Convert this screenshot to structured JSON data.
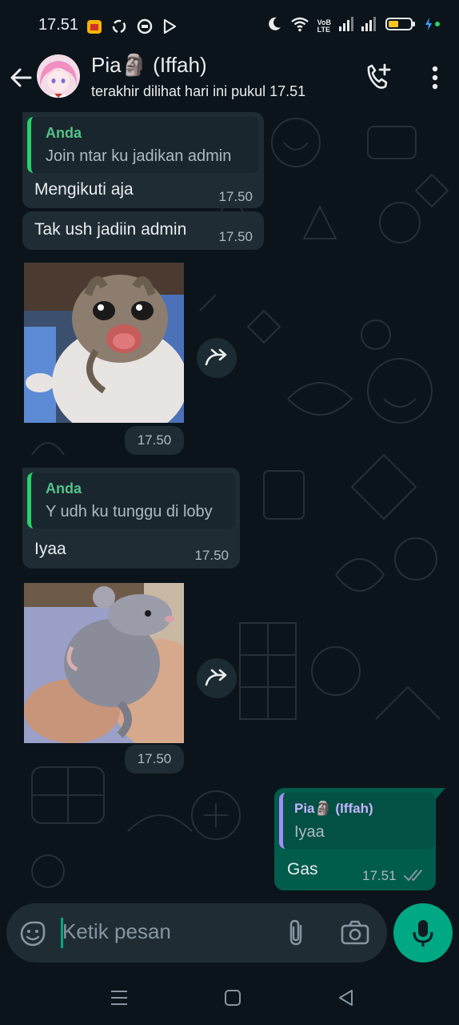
{
  "status_bar": {
    "time": "17.51",
    "net_label_top": "VoB",
    "net_label_bottom": "LTE",
    "app_icons": [
      "app-badge-icon",
      "sync-icon",
      "message-icon",
      "play-store-icon"
    ],
    "right_icons": [
      "moon-icon",
      "wifi-icon",
      "signal-icon",
      "battery-icon",
      "charging-icon"
    ]
  },
  "header": {
    "contact_name": "Pia🗿 (Iffah)",
    "last_seen": "terakhir dilihat hari ini pukul 17.51",
    "icons": [
      "back-arrow-icon",
      "avatar",
      "add-call-icon",
      "more-vertical-icon"
    ]
  },
  "messages": [
    {
      "direction": "in",
      "quote_author": "Anda",
      "quote_text": "Join ntar ku jadikan admin",
      "text": "Mengikuti aja",
      "time": "17.50"
    },
    {
      "direction": "in",
      "text": "Tak ush jadiin admin",
      "time": "17.50"
    },
    {
      "direction": "in",
      "type": "sticker",
      "sticker": "cat-sticker",
      "time": "17.50"
    },
    {
      "direction": "in",
      "quote_author": "Anda",
      "quote_text": "Y udh ku tunggu di loby",
      "text": "Iyaa",
      "time": "17.50"
    },
    {
      "direction": "in",
      "type": "sticker",
      "sticker": "rat-sticker",
      "time": "17.50"
    },
    {
      "direction": "out",
      "quote_author": "Pia🗿 (Iffah)",
      "quote_text": "Iyaa",
      "text": "Gas",
      "time": "17.51",
      "status": "read"
    }
  ],
  "input": {
    "placeholder": "Ketik pesan",
    "icons": [
      "sticker-icon",
      "attach-icon",
      "camera-icon",
      "mic-icon"
    ]
  },
  "nav": {
    "icons": [
      "menu-icon",
      "home-square-icon",
      "back-triangle-icon"
    ]
  },
  "colors": {
    "background": "#0b141a",
    "bubble_in": "#1f2c34",
    "bubble_out": "#005c4b",
    "accent": "#00a884",
    "quote_author": "#52c389",
    "quote_author_out": "#c5b3ff"
  }
}
